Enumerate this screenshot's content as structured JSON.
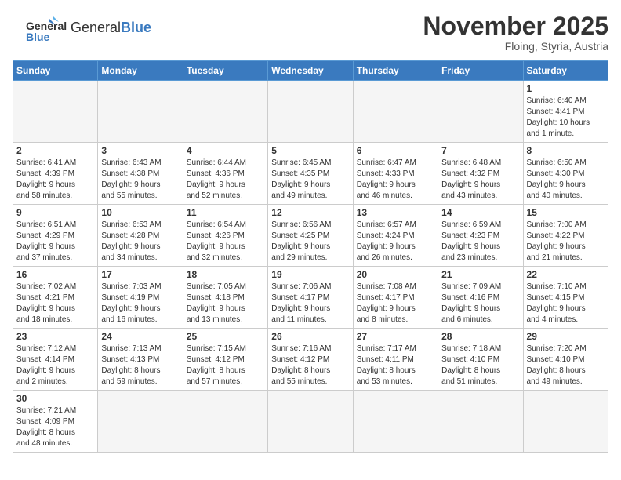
{
  "logo": {
    "text_general": "General",
    "text_blue": "Blue"
  },
  "header": {
    "title": "November 2025",
    "subtitle": "Floing, Styria, Austria"
  },
  "weekdays": [
    "Sunday",
    "Monday",
    "Tuesday",
    "Wednesday",
    "Thursday",
    "Friday",
    "Saturday"
  ],
  "weeks": [
    [
      {
        "day": "",
        "info": ""
      },
      {
        "day": "",
        "info": ""
      },
      {
        "day": "",
        "info": ""
      },
      {
        "day": "",
        "info": ""
      },
      {
        "day": "",
        "info": ""
      },
      {
        "day": "",
        "info": ""
      },
      {
        "day": "1",
        "info": "Sunrise: 6:40 AM\nSunset: 4:41 PM\nDaylight: 10 hours\nand 1 minute."
      }
    ],
    [
      {
        "day": "2",
        "info": "Sunrise: 6:41 AM\nSunset: 4:39 PM\nDaylight: 9 hours\nand 58 minutes."
      },
      {
        "day": "3",
        "info": "Sunrise: 6:43 AM\nSunset: 4:38 PM\nDaylight: 9 hours\nand 55 minutes."
      },
      {
        "day": "4",
        "info": "Sunrise: 6:44 AM\nSunset: 4:36 PM\nDaylight: 9 hours\nand 52 minutes."
      },
      {
        "day": "5",
        "info": "Sunrise: 6:45 AM\nSunset: 4:35 PM\nDaylight: 9 hours\nand 49 minutes."
      },
      {
        "day": "6",
        "info": "Sunrise: 6:47 AM\nSunset: 4:33 PM\nDaylight: 9 hours\nand 46 minutes."
      },
      {
        "day": "7",
        "info": "Sunrise: 6:48 AM\nSunset: 4:32 PM\nDaylight: 9 hours\nand 43 minutes."
      },
      {
        "day": "8",
        "info": "Sunrise: 6:50 AM\nSunset: 4:30 PM\nDaylight: 9 hours\nand 40 minutes."
      }
    ],
    [
      {
        "day": "9",
        "info": "Sunrise: 6:51 AM\nSunset: 4:29 PM\nDaylight: 9 hours\nand 37 minutes."
      },
      {
        "day": "10",
        "info": "Sunrise: 6:53 AM\nSunset: 4:28 PM\nDaylight: 9 hours\nand 34 minutes."
      },
      {
        "day": "11",
        "info": "Sunrise: 6:54 AM\nSunset: 4:26 PM\nDaylight: 9 hours\nand 32 minutes."
      },
      {
        "day": "12",
        "info": "Sunrise: 6:56 AM\nSunset: 4:25 PM\nDaylight: 9 hours\nand 29 minutes."
      },
      {
        "day": "13",
        "info": "Sunrise: 6:57 AM\nSunset: 4:24 PM\nDaylight: 9 hours\nand 26 minutes."
      },
      {
        "day": "14",
        "info": "Sunrise: 6:59 AM\nSunset: 4:23 PM\nDaylight: 9 hours\nand 23 minutes."
      },
      {
        "day": "15",
        "info": "Sunrise: 7:00 AM\nSunset: 4:22 PM\nDaylight: 9 hours\nand 21 minutes."
      }
    ],
    [
      {
        "day": "16",
        "info": "Sunrise: 7:02 AM\nSunset: 4:21 PM\nDaylight: 9 hours\nand 18 minutes."
      },
      {
        "day": "17",
        "info": "Sunrise: 7:03 AM\nSunset: 4:19 PM\nDaylight: 9 hours\nand 16 minutes."
      },
      {
        "day": "18",
        "info": "Sunrise: 7:05 AM\nSunset: 4:18 PM\nDaylight: 9 hours\nand 13 minutes."
      },
      {
        "day": "19",
        "info": "Sunrise: 7:06 AM\nSunset: 4:17 PM\nDaylight: 9 hours\nand 11 minutes."
      },
      {
        "day": "20",
        "info": "Sunrise: 7:08 AM\nSunset: 4:17 PM\nDaylight: 9 hours\nand 8 minutes."
      },
      {
        "day": "21",
        "info": "Sunrise: 7:09 AM\nSunset: 4:16 PM\nDaylight: 9 hours\nand 6 minutes."
      },
      {
        "day": "22",
        "info": "Sunrise: 7:10 AM\nSunset: 4:15 PM\nDaylight: 9 hours\nand 4 minutes."
      }
    ],
    [
      {
        "day": "23",
        "info": "Sunrise: 7:12 AM\nSunset: 4:14 PM\nDaylight: 9 hours\nand 2 minutes."
      },
      {
        "day": "24",
        "info": "Sunrise: 7:13 AM\nSunset: 4:13 PM\nDaylight: 8 hours\nand 59 minutes."
      },
      {
        "day": "25",
        "info": "Sunrise: 7:15 AM\nSunset: 4:12 PM\nDaylight: 8 hours\nand 57 minutes."
      },
      {
        "day": "26",
        "info": "Sunrise: 7:16 AM\nSunset: 4:12 PM\nDaylight: 8 hours\nand 55 minutes."
      },
      {
        "day": "27",
        "info": "Sunrise: 7:17 AM\nSunset: 4:11 PM\nDaylight: 8 hours\nand 53 minutes."
      },
      {
        "day": "28",
        "info": "Sunrise: 7:18 AM\nSunset: 4:10 PM\nDaylight: 8 hours\nand 51 minutes."
      },
      {
        "day": "29",
        "info": "Sunrise: 7:20 AM\nSunset: 4:10 PM\nDaylight: 8 hours\nand 49 minutes."
      }
    ],
    [
      {
        "day": "30",
        "info": "Sunrise: 7:21 AM\nSunset: 4:09 PM\nDaylight: 8 hours\nand 48 minutes."
      },
      {
        "day": "",
        "info": ""
      },
      {
        "day": "",
        "info": ""
      },
      {
        "day": "",
        "info": ""
      },
      {
        "day": "",
        "info": ""
      },
      {
        "day": "",
        "info": ""
      },
      {
        "day": "",
        "info": ""
      }
    ]
  ]
}
